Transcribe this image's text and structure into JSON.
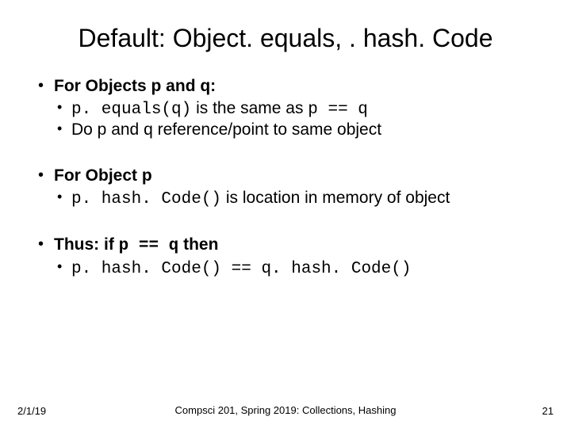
{
  "title": "Default: Object. equals, . hash. Code",
  "b1": {
    "head": "For Objects p and q:",
    "s1a": "p. equals(q)",
    "s1b": " is the same as ",
    "s1c": "p == q",
    "s2": "Do p and q reference/point to same object"
  },
  "b2": {
    "head": "For Object p",
    "s1a": "p. hash. Code()",
    "s1b": " is location in memory of object"
  },
  "b3": {
    "heada": "Thus: if ",
    "headb": "p == q",
    "headc": " then",
    "s1": "p. hash. Code() == q. hash. Code()"
  },
  "footer": {
    "date": "2/1/19",
    "course": "Compsci 201, Spring 2019: Collections, Hashing",
    "page": "21"
  }
}
